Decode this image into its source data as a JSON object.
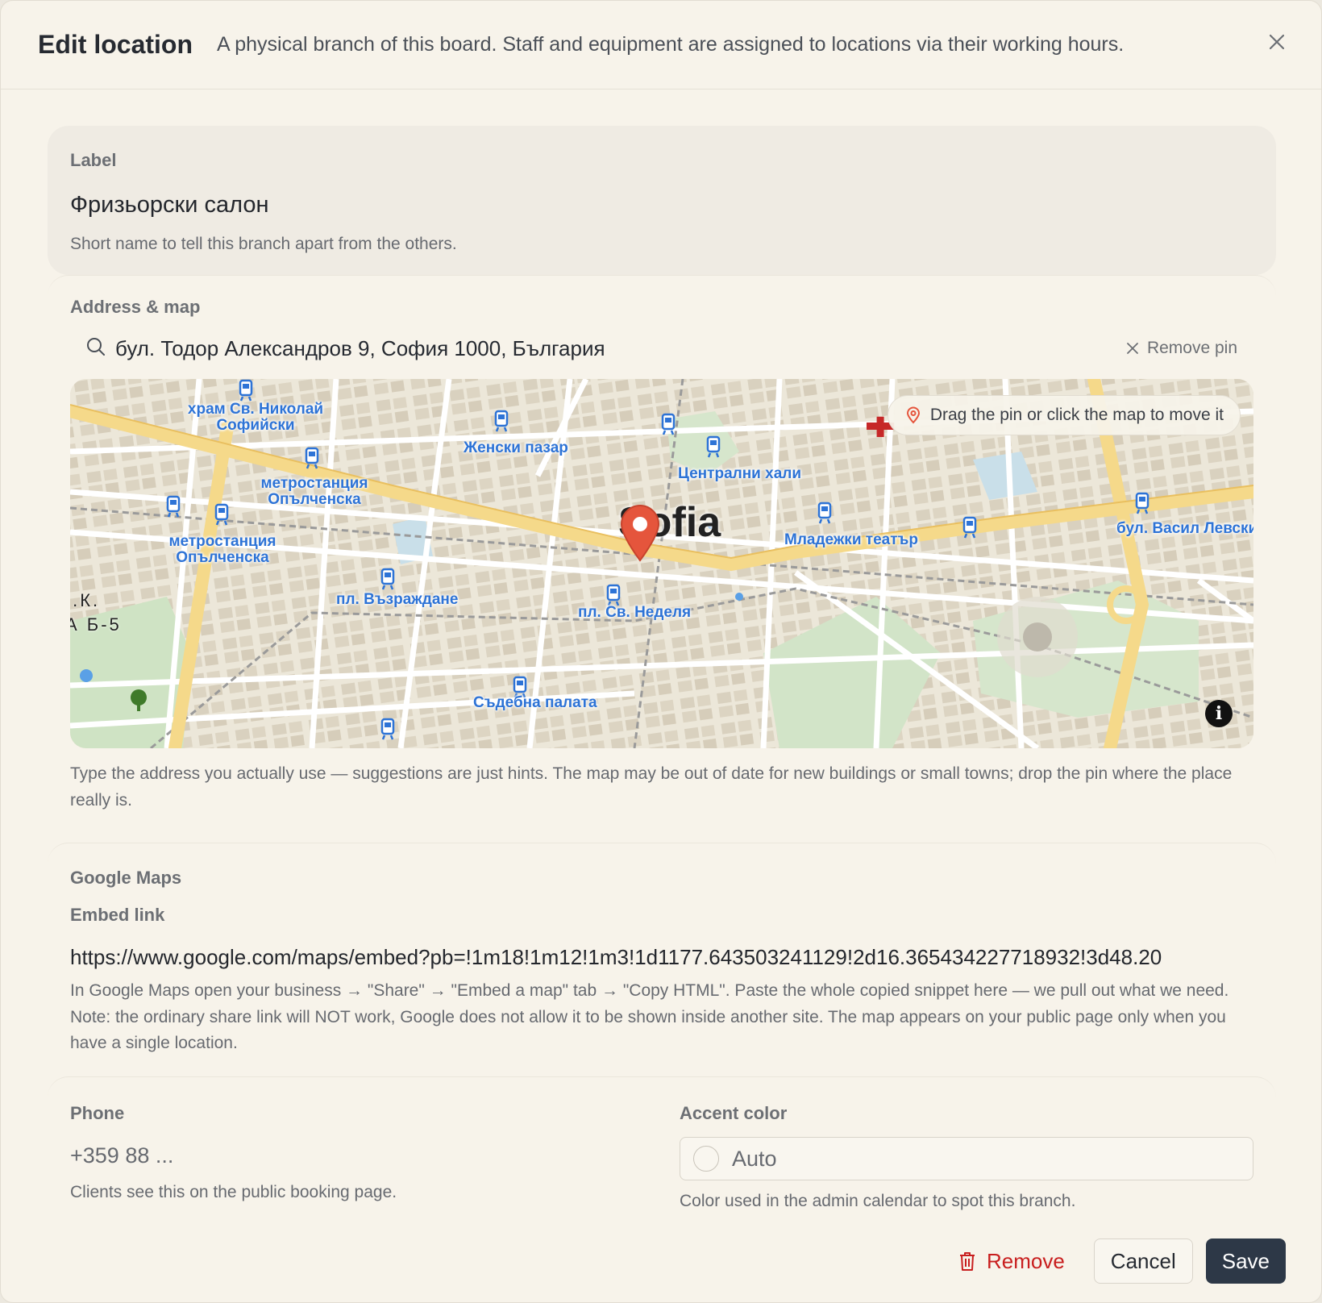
{
  "dialog": {
    "title": "Edit location",
    "subtitle": "A physical branch of this board. Staff and equipment are assigned to locations via their working hours."
  },
  "label_section": {
    "label": "Label",
    "value": "Фризьорски салон",
    "hint": "Short name to tell this branch apart from the others."
  },
  "address_section": {
    "label": "Address & map",
    "address_value": "бул. Тодор Александров 9, София 1000, България",
    "remove_pin": "Remove pin",
    "map_hint": "Drag the pin or click the map to move it",
    "hint": "Type the address you actually use — suggestions are just hints. The map may be out of date for new buildings or small towns; drop the pin where the place really is.",
    "map_labels": {
      "city": "Sofia",
      "church": "храм Св. Николай Софийски",
      "zhenski": "Женски пазар",
      "tsentralni": "Централни хали",
      "metro1": "метростанция Опълченска",
      "metro2": "метростанция Опълченска",
      "mladezhki": "Младежки театър",
      "levski": "бул. Васил Левски",
      "vazrazhdane": "пл. Възраждане",
      "nedelya": "пл. Св. Неделя",
      "sadebna": "Съдебна палата",
      "kk_line1": " .К.",
      "kk_line2": "А Б-5"
    }
  },
  "google_maps_section": {
    "label": "Google Maps",
    "embed_label": "Embed link",
    "embed_value": "https://www.google.com/maps/embed?pb=!1m18!1m12!1m3!1d1177.643503241129!2d16.365434227718932!3d48.20",
    "hint": "In Google Maps open your business → \"Share\" → \"Embed a map\" tab → \"Copy HTML\". Paste the whole copied snippet here — we pull out what we need. Note: the ordinary share link will NOT work, Google does not allow it to be shown inside another site. The map appears on your public page only when you have a single location."
  },
  "phone_section": {
    "label": "Phone",
    "placeholder": "+359 88 ...",
    "hint": "Clients see this on the public booking page."
  },
  "accent_section": {
    "label": "Accent color",
    "value": "Auto",
    "hint": "Color used in the admin calendar to spot this branch."
  },
  "footer": {
    "remove": "Remove",
    "cancel": "Cancel",
    "save": "Save"
  },
  "colors": {
    "save_bg": "#2d3847",
    "remove_text": "#c81e1e",
    "pin": "#e5553c",
    "transit_label": "#2d73d6"
  }
}
